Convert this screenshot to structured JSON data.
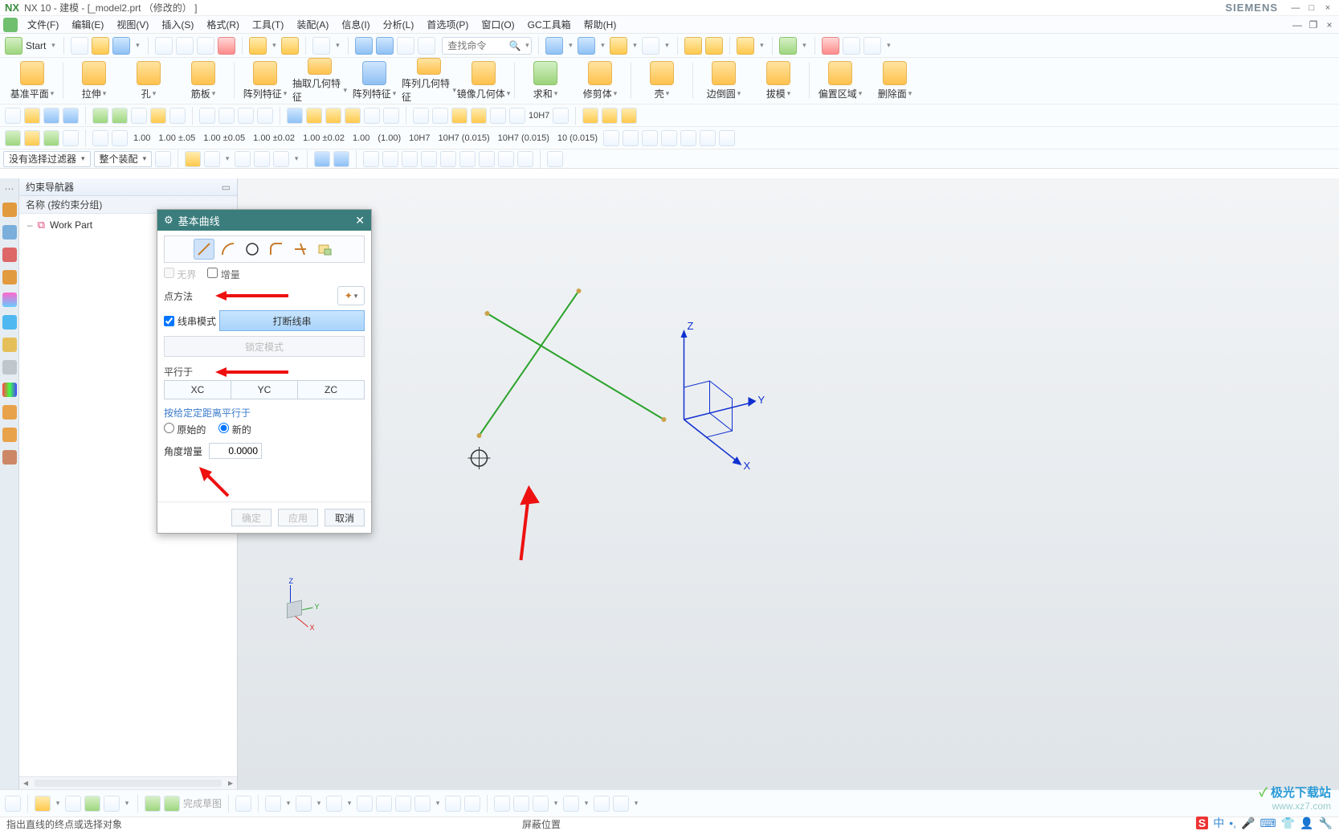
{
  "title": "NX 10 - 建模 - [_model2.prt （修改的） ]",
  "brand": "SIEMENS",
  "window_buttons": {
    "min": "—",
    "restore": "□",
    "close": "×"
  },
  "child_window_buttons": {
    "min": "—",
    "restore": "❐",
    "close": "×"
  },
  "menu": {
    "file": "文件(F)",
    "edit": "编辑(E)",
    "view": "视图(V)",
    "insert": "插入(S)",
    "format": "格式(R)",
    "tools": "工具(T)",
    "assemble": "装配(A)",
    "info": "信息(I)",
    "analysis": "分析(L)",
    "prefs": "首选项(P)",
    "window": "窗口(O)",
    "gc": "GC工具箱",
    "help": "帮助(H)"
  },
  "quickbar": {
    "start": "Start",
    "search_placeholder": "查找命令"
  },
  "ribbon": {
    "items": [
      {
        "label": "基准平面",
        "tone": "orange"
      },
      {
        "label": "拉伸",
        "tone": "orange"
      },
      {
        "label": "孔",
        "tone": "orange"
      },
      {
        "label": "筋板",
        "tone": "orange"
      },
      {
        "label": "阵列特征",
        "tone": "orange"
      },
      {
        "label": "抽取几何特征",
        "tone": "orange"
      },
      {
        "label": "阵列特征",
        "tone": "blue"
      },
      {
        "label": "阵列几何特征",
        "tone": "orange"
      },
      {
        "label": "镜像几何体",
        "tone": "orange"
      },
      {
        "label": "求和",
        "tone": "green"
      },
      {
        "label": "修剪体",
        "tone": "orange"
      },
      {
        "label": "壳",
        "tone": "orange"
      },
      {
        "label": "边倒圆",
        "tone": "orange"
      },
      {
        "label": "拔模",
        "tone": "orange"
      },
      {
        "label": "偏置区域",
        "tone": "orange"
      },
      {
        "label": "删除面",
        "tone": "orange"
      }
    ]
  },
  "dense_row_tokens": {
    "row2a": [
      "1.00",
      "1.00 ±.05",
      "1.00 ±0.05",
      "1.00 ±0.02",
      "1.00 ±0.02",
      "1.00",
      "(1.00)",
      "10H7",
      "10H7 (0.015)",
      "10H7 (0.015)",
      "10 (0.015)"
    ],
    "row1b": [
      "10H7"
    ]
  },
  "filter_row": {
    "combo1": "没有选择过滤器",
    "combo2": "整个装配"
  },
  "navigator": {
    "title": "约束导航器",
    "column_header": "名称 (按约束分组)",
    "root": "Work Part"
  },
  "dialog": {
    "title": "基本曲线",
    "unbounded": "无界",
    "increment": "增量",
    "point_method": "点方法",
    "string_mode": "线串模式",
    "break_string": "打断线串",
    "lock_mode": "锁定模式",
    "parallel_to": "平行于",
    "axes": [
      "XC",
      "YC",
      "ZC"
    ],
    "specified_distance": "按给定定距离平行于",
    "radio_original": "原始的",
    "radio_new": "新的",
    "angle_increment_label": "角度增量",
    "angle_increment_value": "0.0000",
    "ok": "确定",
    "apply": "应用",
    "cancel": "取消"
  },
  "triad": {
    "x": "X",
    "y": "Y",
    "z": "Z"
  },
  "mini_triad": {
    "x": "X",
    "y": "Y",
    "z": "Z"
  },
  "bottom_toolbar": {
    "finish_sketch": "完成草图"
  },
  "status": {
    "left": "指出直线的终点或选择对象",
    "mid": "屏蔽位置"
  },
  "watermark": {
    "line1": "极光下载站",
    "line2": "www.xz7.com"
  }
}
